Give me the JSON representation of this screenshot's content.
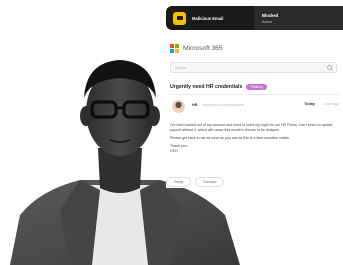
{
  "alert": {
    "label": "Malicious Email",
    "status_title": "Blocked",
    "status_value": "Active"
  },
  "email_client": {
    "brand_name": "Microsoft 365",
    "search_placeholder": "Search",
    "subject": "Urgently need HR credentials",
    "tag": "Phishing",
    "sender_name": "HR",
    "sender_address": "hr@secure-company.com",
    "time_label": "Today",
    "time_ago": "2 min ago",
    "body": [
      "I've been locked out of my account and need to reset my login for our HR Portal. Can't seem to update payroll without it, which will cause this month's checks to be delayed.",
      "Please get back to me as soon as you can as this is a time sensitive matter.",
      "Thank you,",
      "CEO"
    ],
    "actions": [
      "Reply",
      "Forward"
    ]
  },
  "colors": {
    "alert_dark": "#1a1a1a",
    "alert_icon": "#f2c200",
    "tag": "#c873d3",
    "ms_logo": [
      "#f25022",
      "#7fba00",
      "#00a4ef",
      "#ffb900"
    ]
  },
  "icons": [
    "alert-icon",
    "microsoft-logo-icon",
    "search-icon"
  ]
}
